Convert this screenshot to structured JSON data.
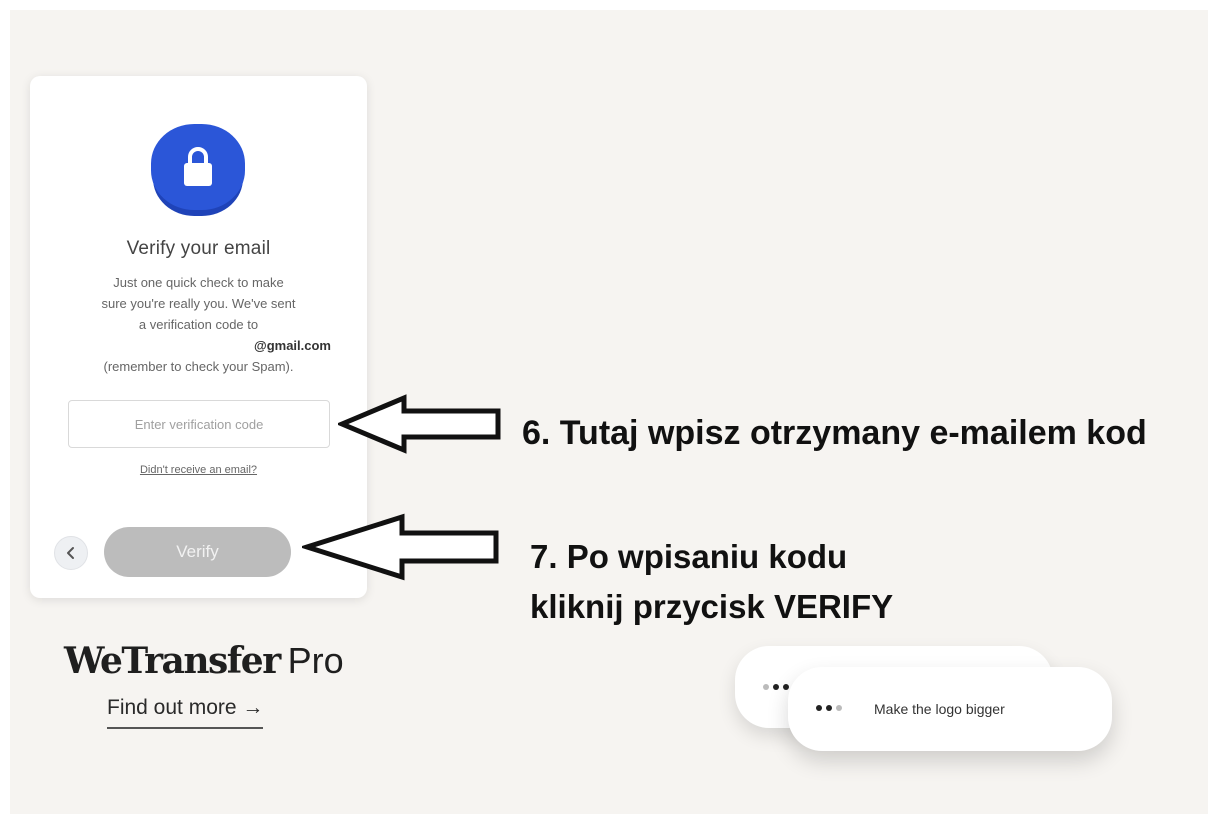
{
  "dialog": {
    "title": "Verify your email",
    "body_lines": [
      "Just one quick check to make",
      "sure you're really you. We've sent",
      "a verification code to"
    ],
    "email": "@gmail.com",
    "spam_note": "(remember to check your Spam).",
    "code_input": {
      "value": "",
      "placeholder": "Enter verification code"
    },
    "resend_link": "Didn't receive an email?",
    "verify_button": "Verify",
    "back_icon": "chevron-left-icon",
    "lock_icon": "padlock-icon",
    "accent_color": "#2b56d8",
    "disabled_button_color": "#bcbcbc"
  },
  "brand": {
    "name": "WeTransfer",
    "tier": "Pro",
    "cta": "Find out more →"
  },
  "annotations": {
    "step6": "6. Tutaj wpisz otrzymany e-mailem kod",
    "step7_line1": "7. Po wpisaniu kodu",
    "step7_line2": "kliknij przycisk VERIFY"
  },
  "chat_bubble": {
    "text": "Make the logo bigger"
  }
}
